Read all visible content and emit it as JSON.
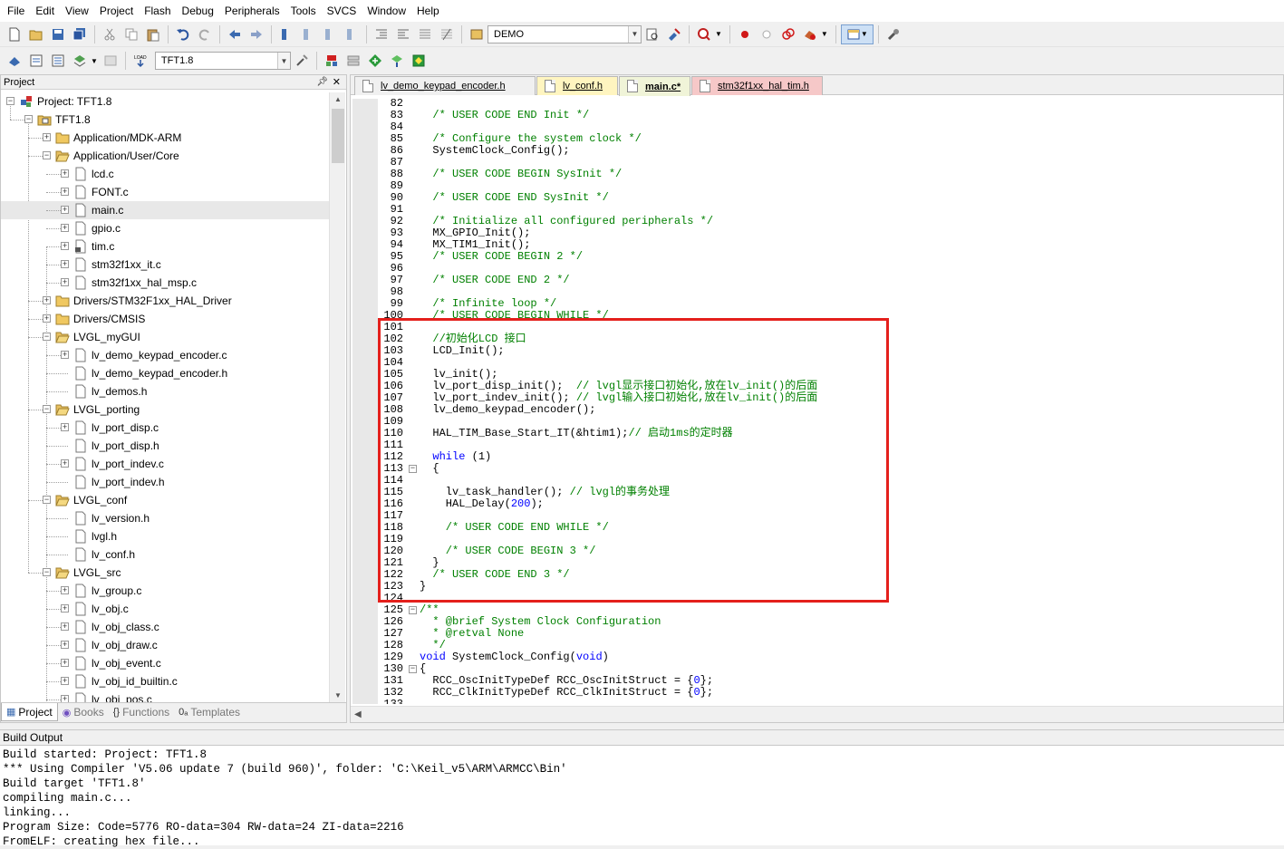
{
  "menu": [
    "File",
    "Edit",
    "View",
    "Project",
    "Flash",
    "Debug",
    "Peripherals",
    "Tools",
    "SVCS",
    "Window",
    "Help"
  ],
  "toolbar1": {
    "target_combo": "DEMO"
  },
  "toolbar2": {
    "target_combo": "TFT1.8"
  },
  "project_pane": {
    "title": "Project",
    "tree": [
      {
        "label": "Project: TFT1.8",
        "icon": "project-icon",
        "level": 0,
        "expander": "minus"
      },
      {
        "label": "TFT1.8",
        "icon": "target-folder-icon",
        "level": 1,
        "expander": "minus"
      },
      {
        "label": "Application/MDK-ARM",
        "icon": "folder-icon",
        "level": 2,
        "expander": "plus"
      },
      {
        "label": "Application/User/Core",
        "icon": "folder-open-icon",
        "level": 2,
        "expander": "minus"
      },
      {
        "label": "lcd.c",
        "icon": "file-icon",
        "level": 3,
        "expander": "plus"
      },
      {
        "label": "FONT.c",
        "icon": "file-icon",
        "level": 3,
        "expander": "plus"
      },
      {
        "label": "main.c",
        "icon": "file-icon",
        "level": 3,
        "expander": "plus",
        "selected": true
      },
      {
        "label": "gpio.c",
        "icon": "file-icon",
        "level": 3,
        "expander": "plus"
      },
      {
        "label": "tim.c",
        "icon": "file-locked-icon",
        "level": 3,
        "expander": "plus"
      },
      {
        "label": "stm32f1xx_it.c",
        "icon": "file-icon",
        "level": 3,
        "expander": "plus"
      },
      {
        "label": "stm32f1xx_hal_msp.c",
        "icon": "file-icon",
        "level": 3,
        "expander": "plus"
      },
      {
        "label": "Drivers/STM32F1xx_HAL_Driver",
        "icon": "folder-icon",
        "level": 2,
        "expander": "plus"
      },
      {
        "label": "Drivers/CMSIS",
        "icon": "folder-icon",
        "level": 2,
        "expander": "plus"
      },
      {
        "label": "LVGL_myGUI",
        "icon": "folder-open-icon",
        "level": 2,
        "expander": "minus"
      },
      {
        "label": "lv_demo_keypad_encoder.c",
        "icon": "file-icon",
        "level": 3,
        "expander": "plus"
      },
      {
        "label": "lv_demo_keypad_encoder.h",
        "icon": "file-icon",
        "level": 3,
        "expander": "none"
      },
      {
        "label": "lv_demos.h",
        "icon": "file-icon",
        "level": 3,
        "expander": "none"
      },
      {
        "label": "LVGL_porting",
        "icon": "folder-open-icon",
        "level": 2,
        "expander": "minus"
      },
      {
        "label": "lv_port_disp.c",
        "icon": "file-icon",
        "level": 3,
        "expander": "plus"
      },
      {
        "label": "lv_port_disp.h",
        "icon": "file-icon",
        "level": 3,
        "expander": "none"
      },
      {
        "label": "lv_port_indev.c",
        "icon": "file-icon",
        "level": 3,
        "expander": "plus"
      },
      {
        "label": "lv_port_indev.h",
        "icon": "file-icon",
        "level": 3,
        "expander": "none"
      },
      {
        "label": "LVGL_conf",
        "icon": "folder-open-icon",
        "level": 2,
        "expander": "minus"
      },
      {
        "label": "lv_version.h",
        "icon": "file-icon",
        "level": 3,
        "expander": "none"
      },
      {
        "label": "lvgl.h",
        "icon": "file-icon",
        "level": 3,
        "expander": "none"
      },
      {
        "label": "lv_conf.h",
        "icon": "file-icon",
        "level": 3,
        "expander": "none"
      },
      {
        "label": "LVGL_src",
        "icon": "folder-open-icon",
        "level": 2,
        "expander": "minus"
      },
      {
        "label": "lv_group.c",
        "icon": "file-icon",
        "level": 3,
        "expander": "plus"
      },
      {
        "label": "lv_obj.c",
        "icon": "file-icon",
        "level": 3,
        "expander": "plus"
      },
      {
        "label": "lv_obj_class.c",
        "icon": "file-icon",
        "level": 3,
        "expander": "plus"
      },
      {
        "label": "lv_obj_draw.c",
        "icon": "file-icon",
        "level": 3,
        "expander": "plus"
      },
      {
        "label": "lv_obj_event.c",
        "icon": "file-icon",
        "level": 3,
        "expander": "plus"
      },
      {
        "label": "lv_obj_id_builtin.c",
        "icon": "file-icon",
        "level": 3,
        "expander": "plus"
      },
      {
        "label": "lv_obj_pos.c",
        "icon": "file-icon",
        "level": 3,
        "expander": "plus"
      }
    ],
    "bottom_tabs": [
      {
        "label": "Project",
        "icon": "project-tab-icon",
        "active": true
      },
      {
        "label": "Books",
        "icon": "books-icon",
        "active": false
      },
      {
        "label": "Functions",
        "icon": "functions-icon",
        "active": false
      },
      {
        "label": "Templates",
        "icon": "templates-icon",
        "active": false
      }
    ]
  },
  "editor": {
    "tabs": [
      {
        "label": "lv_demo_keypad_encoder.h",
        "color": "#f0f0f0",
        "active": false
      },
      {
        "label": "lv_conf.h",
        "color": "#fff5c0",
        "active": false
      },
      {
        "label": "main.c*",
        "color": "#f0f4d8",
        "active": true
      },
      {
        "label": "stm32f1xx_hal_tim.h",
        "color": "#f6c8c8",
        "active": false
      }
    ],
    "highlight_color": "#e4201c",
    "lines": [
      {
        "n": "82",
        "t": "",
        "c": ""
      },
      {
        "n": "83",
        "t": "  /* USER CODE END Init */",
        "c": "cm"
      },
      {
        "n": "84",
        "t": "",
        "c": ""
      },
      {
        "n": "85",
        "t": "  /* Configure the system clock */",
        "c": "cm"
      },
      {
        "n": "86",
        "t": "  SystemClock_Config();",
        "c": ""
      },
      {
        "n": "87",
        "t": "",
        "c": ""
      },
      {
        "n": "88",
        "t": "  /* USER CODE BEGIN SysInit */",
        "c": "cm"
      },
      {
        "n": "89",
        "t": "",
        "c": ""
      },
      {
        "n": "90",
        "t": "  /* USER CODE END SysInit */",
        "c": "cm"
      },
      {
        "n": "91",
        "t": "",
        "c": ""
      },
      {
        "n": "92",
        "t": "  /* Initialize all configured peripherals */",
        "c": "cm"
      },
      {
        "n": "93",
        "t": "  MX_GPIO_Init();",
        "c": ""
      },
      {
        "n": "94",
        "t": "  MX_TIM1_Init();",
        "c": ""
      },
      {
        "n": "95",
        "t": "  /* USER CODE BEGIN 2 */",
        "c": "cm"
      },
      {
        "n": "96",
        "t": "",
        "c": ""
      },
      {
        "n": "97",
        "t": "  /* USER CODE END 2 */",
        "c": "cm"
      },
      {
        "n": "98",
        "t": "",
        "c": ""
      },
      {
        "n": "99",
        "t": "  /* Infinite loop */",
        "c": "cm"
      },
      {
        "n": "100",
        "t": "  /* USER CODE BEGIN WHILE */",
        "c": "cm"
      },
      {
        "n": "101",
        "t": "",
        "c": ""
      },
      {
        "n": "102",
        "t": "  //初始化LCD 接口",
        "c": "cm"
      },
      {
        "n": "103",
        "t": "  LCD_Init();",
        "c": ""
      },
      {
        "n": "104",
        "t": "",
        "c": ""
      },
      {
        "n": "105",
        "t": "  lv_init();",
        "c": ""
      },
      {
        "n": "106",
        "t": "  lv_port_disp_init();  ",
        "c": "",
        "tail": "// lvgl显示接口初始化,放在lv_init()的后面"
      },
      {
        "n": "107",
        "t": "  lv_port_indev_init(); ",
        "c": "",
        "tail": "// lvgl输入接口初始化,放在lv_init()的后面"
      },
      {
        "n": "108",
        "t": "  lv_demo_keypad_encoder();",
        "c": ""
      },
      {
        "n": "109",
        "t": "",
        "c": ""
      },
      {
        "n": "110",
        "t": "  HAL_TIM_Base_Start_IT(&htim1);",
        "c": "",
        "tail": "// 启动1ms的定时器"
      },
      {
        "n": "111",
        "t": "",
        "c": ""
      },
      {
        "n": "112",
        "t": "  while (1)",
        "c": "while"
      },
      {
        "n": "113",
        "t": "  {",
        "c": "",
        "fold": "-"
      },
      {
        "n": "114",
        "t": "",
        "c": ""
      },
      {
        "n": "115",
        "t": "    lv_task_handler(); ",
        "c": "",
        "tail": "// lvgl的事务处理"
      },
      {
        "n": "116",
        "t": "    HAL_Delay(200);",
        "c": "delay"
      },
      {
        "n": "117",
        "t": "",
        "c": ""
      },
      {
        "n": "118",
        "t": "    /* USER CODE END WHILE */",
        "c": "cm"
      },
      {
        "n": "119",
        "t": "",
        "c": ""
      },
      {
        "n": "120",
        "t": "    /* USER CODE BEGIN 3 */",
        "c": "cm"
      },
      {
        "n": "121",
        "t": "  }",
        "c": ""
      },
      {
        "n": "122",
        "t": "  /* USER CODE END 3 */",
        "c": "cm"
      },
      {
        "n": "123",
        "t": "}",
        "c": ""
      },
      {
        "n": "124",
        "t": "",
        "c": ""
      },
      {
        "n": "125",
        "t": "/**",
        "c": "cm",
        "fold": "-"
      },
      {
        "n": "126",
        "t": "  * @brief System Clock Configuration",
        "c": "cm"
      },
      {
        "n": "127",
        "t": "  * @retval None",
        "c": "cm"
      },
      {
        "n": "128",
        "t": "  */",
        "c": "cm"
      },
      {
        "n": "129",
        "t": "void SystemClock_Config(void)",
        "c": "void"
      },
      {
        "n": "130",
        "t": "{",
        "c": "",
        "fold": "-"
      },
      {
        "n": "131",
        "t": "  RCC_OscInitTypeDef RCC_OscInitStruct = {0};",
        "c": "zero"
      },
      {
        "n": "132",
        "t": "  RCC_ClkInitTypeDef RCC_ClkInitStruct = {0};",
        "c": "zero"
      },
      {
        "n": "133",
        "t": "",
        "c": ""
      }
    ]
  },
  "build_output": {
    "title": "Build Output",
    "lines": [
      "Build started: Project: TFT1.8",
      "*** Using Compiler 'V5.06 update 7 (build 960)', folder: 'C:\\Keil_v5\\ARM\\ARMCC\\Bin'",
      "Build target 'TFT1.8'",
      "compiling main.c...",
      "linking...",
      "Program Size: Code=5776 RO-data=304 RW-data=24 ZI-data=2216",
      "FromELF: creating hex file..."
    ]
  }
}
